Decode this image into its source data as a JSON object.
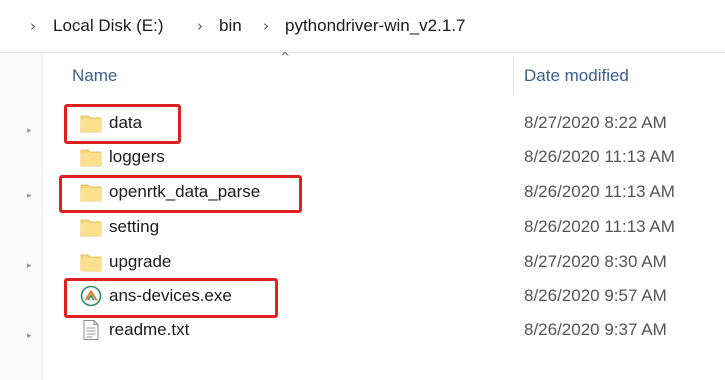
{
  "breadcrumb": {
    "items": [
      "Local Disk (E:)",
      "bin",
      "pythondriver-win_v2.1.7"
    ]
  },
  "columns": {
    "name": "Name",
    "date_modified": "Date modified"
  },
  "files": [
    {
      "name": "data",
      "date": "8/27/2020 8:22 AM",
      "icon": "folder-icon",
      "highlighted": true
    },
    {
      "name": "loggers",
      "date": "8/26/2020 11:13 AM",
      "icon": "folder-icon",
      "highlighted": false
    },
    {
      "name": "openrtk_data_parse",
      "date": "8/26/2020 11:13 AM",
      "icon": "folder-icon",
      "highlighted": true
    },
    {
      "name": "setting",
      "date": "8/26/2020 11:13 AM",
      "icon": "folder-icon",
      "highlighted": false
    },
    {
      "name": "upgrade",
      "date": "8/27/2020 8:30 AM",
      "icon": "folder-icon",
      "highlighted": false
    },
    {
      "name": "ans-devices.exe",
      "date": "8/26/2020 9:57 AM",
      "icon": "app-icon",
      "highlighted": true
    },
    {
      "name": "readme.txt",
      "date": "8/26/2020 9:37 AM",
      "icon": "text-file-icon",
      "highlighted": false
    }
  ],
  "colors": {
    "highlight": "#e02020",
    "folder": "#f8d775",
    "header_text": "#3a5f8a"
  }
}
